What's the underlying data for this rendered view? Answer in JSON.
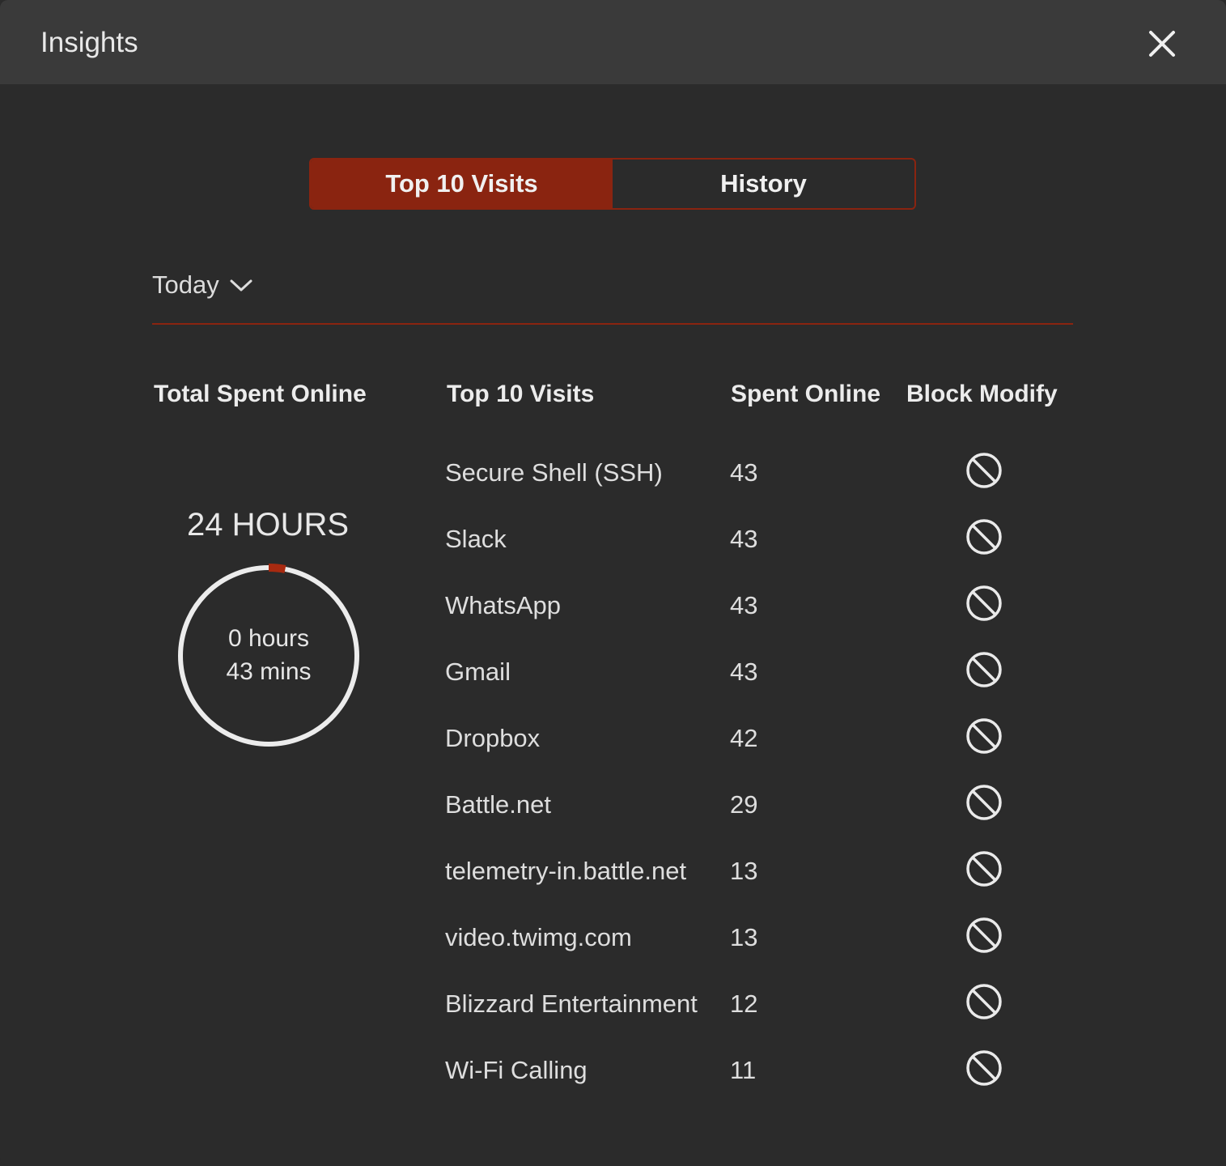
{
  "window": {
    "title": "Insights",
    "close_icon": "close-icon"
  },
  "tabs": [
    {
      "label": "Top 10 Visits",
      "active": true
    },
    {
      "label": "History",
      "active": false
    }
  ],
  "period": {
    "selected": "Today",
    "icon": "chevron-down-icon"
  },
  "headers": {
    "total": "Total Spent Online",
    "visits": "Top 10 Visits",
    "spent": "Spent Online",
    "block": "Block Modify"
  },
  "summary": {
    "period_label": "24 HOURS",
    "hours": "0 hours",
    "mins": "43 mins",
    "progress_fraction": 0.03
  },
  "visits": [
    {
      "name": "Secure Shell (SSH)",
      "value": "43"
    },
    {
      "name": "Slack",
      "value": "43"
    },
    {
      "name": "WhatsApp",
      "value": "43"
    },
    {
      "name": "Gmail",
      "value": "43"
    },
    {
      "name": "Dropbox",
      "value": "42"
    },
    {
      "name": "Battle.net",
      "value": "29"
    },
    {
      "name": "telemetry-in.battle.net",
      "value": "13"
    },
    {
      "name": "video.twimg.com",
      "value": "13"
    },
    {
      "name": "Blizzard Entertainment",
      "value": "12"
    },
    {
      "name": "Wi-Fi Calling",
      "value": "11"
    }
  ],
  "colors": {
    "accent": "#8a2410",
    "background": "#2b2b2b",
    "titlebar": "#3a3a3a"
  }
}
